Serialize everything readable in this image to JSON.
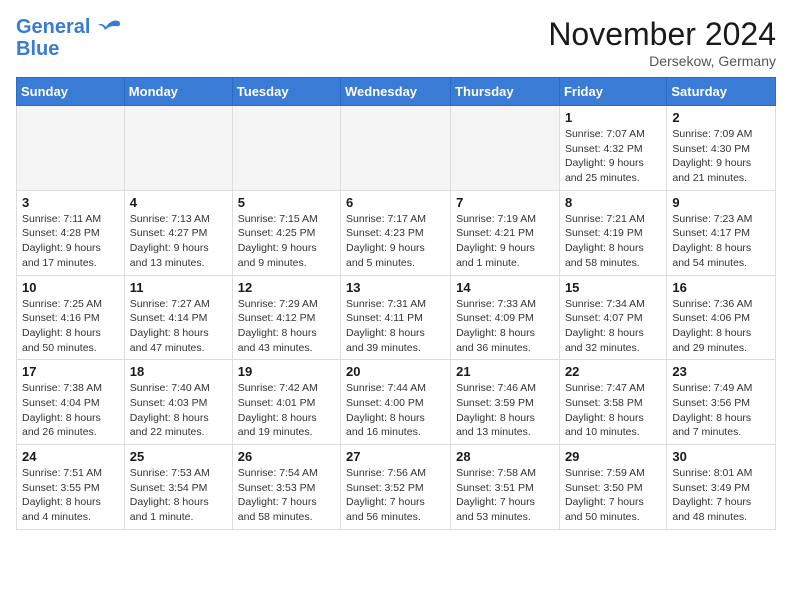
{
  "header": {
    "logo_line1": "General",
    "logo_line2": "Blue",
    "month_title": "November 2024",
    "location": "Dersekow, Germany"
  },
  "weekdays": [
    "Sunday",
    "Monday",
    "Tuesday",
    "Wednesday",
    "Thursday",
    "Friday",
    "Saturday"
  ],
  "weeks": [
    [
      {
        "day": "",
        "info": ""
      },
      {
        "day": "",
        "info": ""
      },
      {
        "day": "",
        "info": ""
      },
      {
        "day": "",
        "info": ""
      },
      {
        "day": "",
        "info": ""
      },
      {
        "day": "1",
        "info": "Sunrise: 7:07 AM\nSunset: 4:32 PM\nDaylight: 9 hours\nand 25 minutes."
      },
      {
        "day": "2",
        "info": "Sunrise: 7:09 AM\nSunset: 4:30 PM\nDaylight: 9 hours\nand 21 minutes."
      }
    ],
    [
      {
        "day": "3",
        "info": "Sunrise: 7:11 AM\nSunset: 4:28 PM\nDaylight: 9 hours\nand 17 minutes."
      },
      {
        "day": "4",
        "info": "Sunrise: 7:13 AM\nSunset: 4:27 PM\nDaylight: 9 hours\nand 13 minutes."
      },
      {
        "day": "5",
        "info": "Sunrise: 7:15 AM\nSunset: 4:25 PM\nDaylight: 9 hours\nand 9 minutes."
      },
      {
        "day": "6",
        "info": "Sunrise: 7:17 AM\nSunset: 4:23 PM\nDaylight: 9 hours\nand 5 minutes."
      },
      {
        "day": "7",
        "info": "Sunrise: 7:19 AM\nSunset: 4:21 PM\nDaylight: 9 hours\nand 1 minute."
      },
      {
        "day": "8",
        "info": "Sunrise: 7:21 AM\nSunset: 4:19 PM\nDaylight: 8 hours\nand 58 minutes."
      },
      {
        "day": "9",
        "info": "Sunrise: 7:23 AM\nSunset: 4:17 PM\nDaylight: 8 hours\nand 54 minutes."
      }
    ],
    [
      {
        "day": "10",
        "info": "Sunrise: 7:25 AM\nSunset: 4:16 PM\nDaylight: 8 hours\nand 50 minutes."
      },
      {
        "day": "11",
        "info": "Sunrise: 7:27 AM\nSunset: 4:14 PM\nDaylight: 8 hours\nand 47 minutes."
      },
      {
        "day": "12",
        "info": "Sunrise: 7:29 AM\nSunset: 4:12 PM\nDaylight: 8 hours\nand 43 minutes."
      },
      {
        "day": "13",
        "info": "Sunrise: 7:31 AM\nSunset: 4:11 PM\nDaylight: 8 hours\nand 39 minutes."
      },
      {
        "day": "14",
        "info": "Sunrise: 7:33 AM\nSunset: 4:09 PM\nDaylight: 8 hours\nand 36 minutes."
      },
      {
        "day": "15",
        "info": "Sunrise: 7:34 AM\nSunset: 4:07 PM\nDaylight: 8 hours\nand 32 minutes."
      },
      {
        "day": "16",
        "info": "Sunrise: 7:36 AM\nSunset: 4:06 PM\nDaylight: 8 hours\nand 29 minutes."
      }
    ],
    [
      {
        "day": "17",
        "info": "Sunrise: 7:38 AM\nSunset: 4:04 PM\nDaylight: 8 hours\nand 26 minutes."
      },
      {
        "day": "18",
        "info": "Sunrise: 7:40 AM\nSunset: 4:03 PM\nDaylight: 8 hours\nand 22 minutes."
      },
      {
        "day": "19",
        "info": "Sunrise: 7:42 AM\nSunset: 4:01 PM\nDaylight: 8 hours\nand 19 minutes."
      },
      {
        "day": "20",
        "info": "Sunrise: 7:44 AM\nSunset: 4:00 PM\nDaylight: 8 hours\nand 16 minutes."
      },
      {
        "day": "21",
        "info": "Sunrise: 7:46 AM\nSunset: 3:59 PM\nDaylight: 8 hours\nand 13 minutes."
      },
      {
        "day": "22",
        "info": "Sunrise: 7:47 AM\nSunset: 3:58 PM\nDaylight: 8 hours\nand 10 minutes."
      },
      {
        "day": "23",
        "info": "Sunrise: 7:49 AM\nSunset: 3:56 PM\nDaylight: 8 hours\nand 7 minutes."
      }
    ],
    [
      {
        "day": "24",
        "info": "Sunrise: 7:51 AM\nSunset: 3:55 PM\nDaylight: 8 hours\nand 4 minutes."
      },
      {
        "day": "25",
        "info": "Sunrise: 7:53 AM\nSunset: 3:54 PM\nDaylight: 8 hours\nand 1 minute."
      },
      {
        "day": "26",
        "info": "Sunrise: 7:54 AM\nSunset: 3:53 PM\nDaylight: 7 hours\nand 58 minutes."
      },
      {
        "day": "27",
        "info": "Sunrise: 7:56 AM\nSunset: 3:52 PM\nDaylight: 7 hours\nand 56 minutes."
      },
      {
        "day": "28",
        "info": "Sunrise: 7:58 AM\nSunset: 3:51 PM\nDaylight: 7 hours\nand 53 minutes."
      },
      {
        "day": "29",
        "info": "Sunrise: 7:59 AM\nSunset: 3:50 PM\nDaylight: 7 hours\nand 50 minutes."
      },
      {
        "day": "30",
        "info": "Sunrise: 8:01 AM\nSunset: 3:49 PM\nDaylight: 7 hours\nand 48 minutes."
      }
    ]
  ]
}
